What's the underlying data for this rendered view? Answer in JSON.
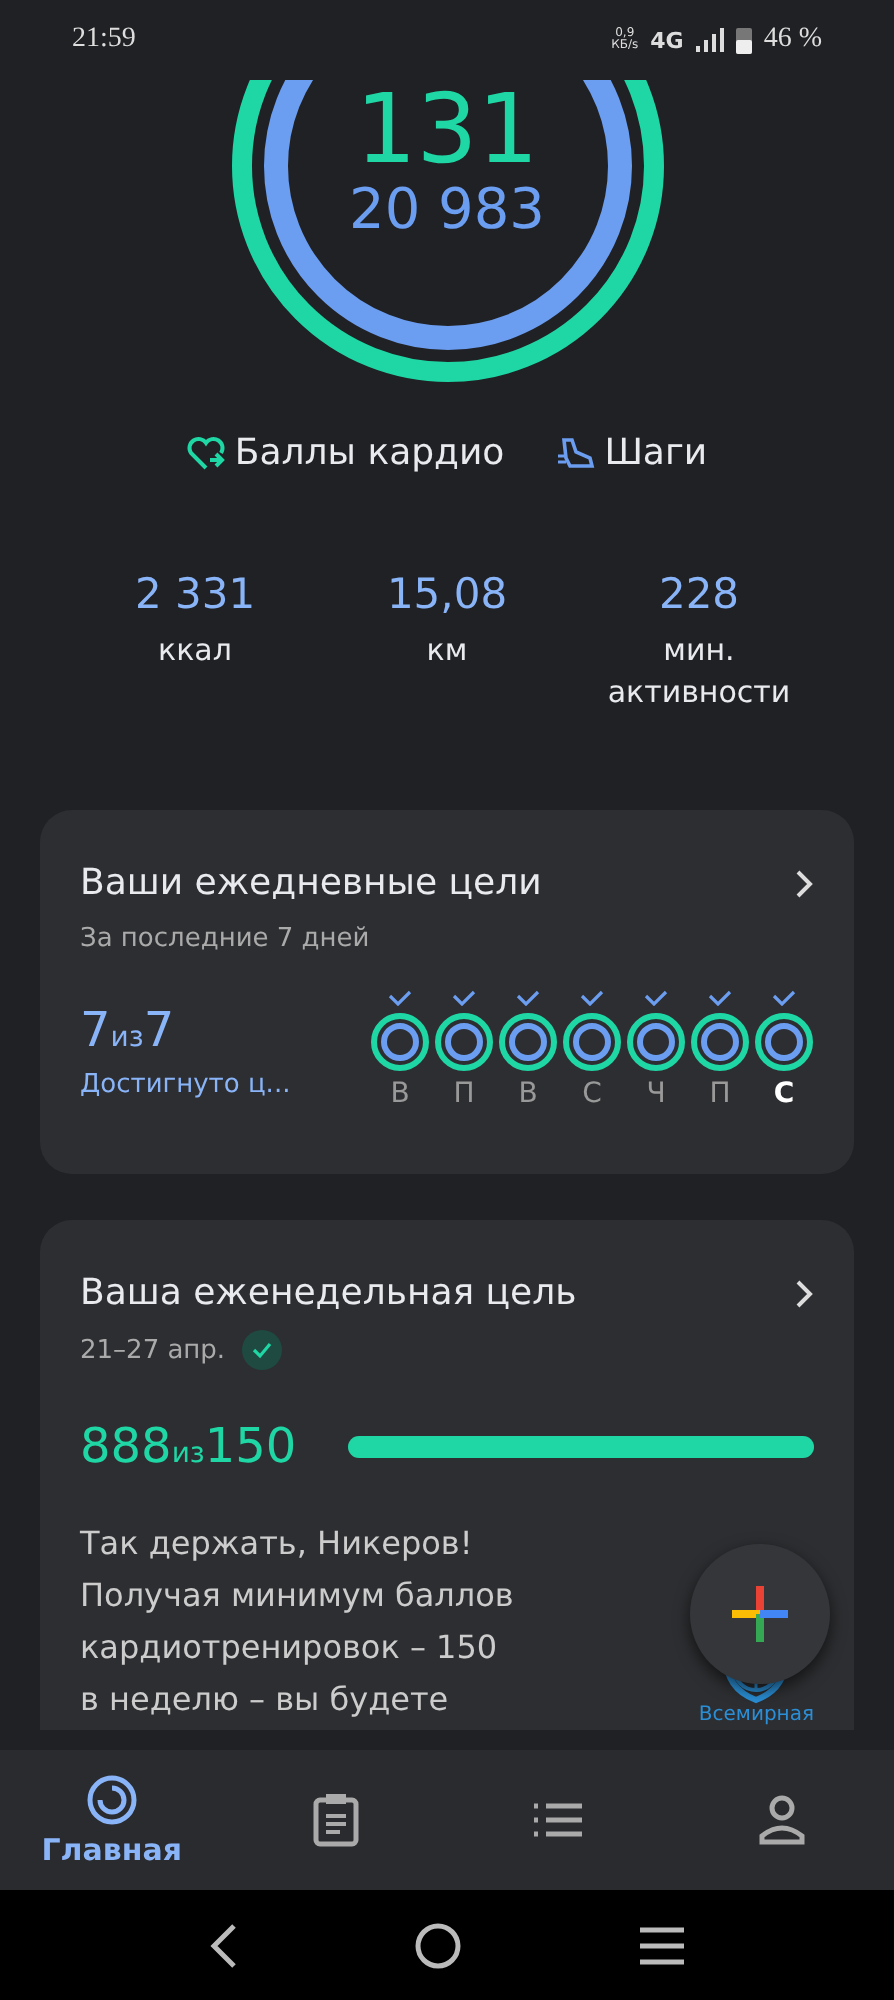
{
  "status_bar": {
    "time": "21:59",
    "speed": "0,9\nКБ/s",
    "network": "4G",
    "battery": "46 %"
  },
  "rings": {
    "cardio": {
      "value": "131"
    },
    "steps": {
      "value": "20 983"
    }
  },
  "legend": [
    {
      "kind": "cardio",
      "label": "Баллы кардио"
    },
    {
      "kind": "steps",
      "label": "Шаги"
    }
  ],
  "stats": [
    {
      "value": "2 331",
      "label": "ккал"
    },
    {
      "value": "15,08",
      "label": "км"
    },
    {
      "value": "228",
      "label": "мин. активности"
    }
  ],
  "daily_goals": {
    "title": "Ваши ежедневные цели",
    "subtitle": "За последние 7 дней",
    "done": "7",
    "of": "из",
    "total": "7",
    "caption": "Достигнуто ц...",
    "days": [
      {
        "label": "В",
        "achieved": true,
        "today": false
      },
      {
        "label": "П",
        "achieved": true,
        "today": false
      },
      {
        "label": "В",
        "achieved": true,
        "today": false
      },
      {
        "label": "С",
        "achieved": true,
        "today": false
      },
      {
        "label": "Ч",
        "achieved": true,
        "today": false
      },
      {
        "label": "П",
        "achieved": true,
        "today": false
      },
      {
        "label": "С",
        "achieved": true,
        "today": true
      }
    ]
  },
  "weekly_goal": {
    "title": "Ваша еженедельная цель",
    "dates": "21–27 апр.",
    "achieved": true,
    "done": "888",
    "of": "из",
    "total": "150",
    "level": 1,
    "text": "Так держать, Никеров! Получая минимум баллов кардиотренировок – 150 в неделю – вы будете",
    "source": "Всемирная"
  },
  "bottom_nav": [
    {
      "kind": "home",
      "label": "Главная",
      "selected": true
    },
    {
      "kind": "journal",
      "selected": false
    },
    {
      "kind": "browse",
      "selected": false
    },
    {
      "kind": "profile",
      "selected": false
    }
  ]
}
